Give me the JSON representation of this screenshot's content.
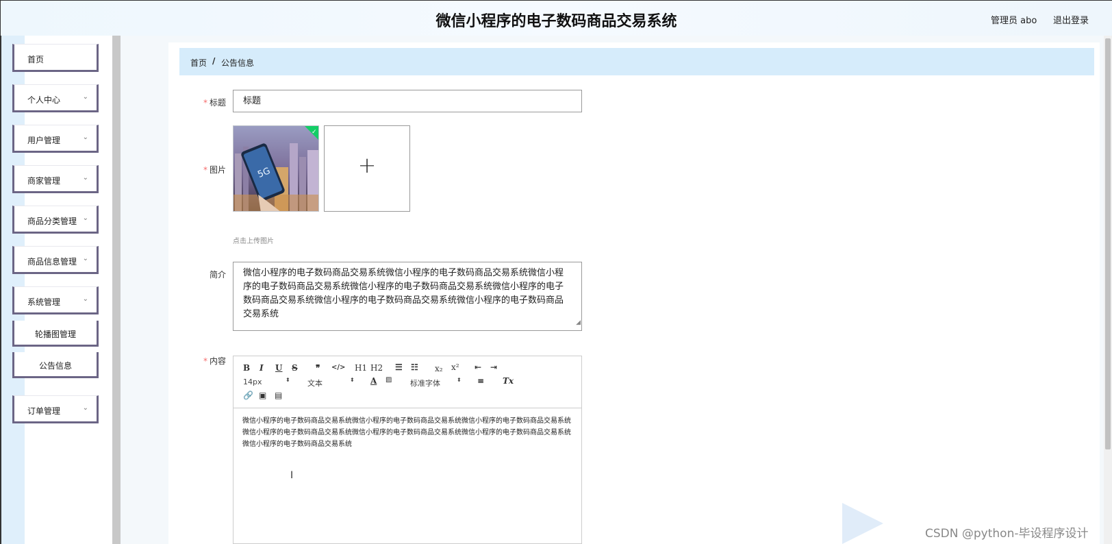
{
  "header": {
    "title": "微信小程序的电子数码商品交易系统",
    "admin_label": "管理员 abo",
    "logout_label": "退出登录"
  },
  "sidebar": {
    "items": [
      {
        "label": "首页"
      },
      {
        "label": "个人中心"
      },
      {
        "label": "用户管理"
      },
      {
        "label": "商家管理"
      },
      {
        "label": "商品分类管理"
      },
      {
        "label": "商品信息管理"
      },
      {
        "label": "系统管理"
      },
      {
        "label": "轮播图管理"
      },
      {
        "label": "公告信息"
      },
      {
        "label": "订单管理"
      }
    ]
  },
  "breadcrumb": {
    "home": "首页",
    "separator": "/",
    "current": "公告信息"
  },
  "form": {
    "title_label": "标题",
    "title_value": "标题",
    "image_label": "图片",
    "upload_tip": "点击上传图片",
    "summary_label": "简介",
    "summary_value": "微信小程序的电子数码商品交易系统微信小程序的电子数码商品交易系统微信小程序的电子数码商品交易系统微信小程序的电子数码商品交易系统微信小程序的电子数码商品交易系统微信小程序的电子数码商品交易系统微信小程序的电子数码商品交易系统",
    "content_label": "内容",
    "content_value": "微信小程序的电子数码商品交易系统微信小程序的电子数码商品交易系统微信小程序的电子数码商品交易系统微信小程序的电子数码商品交易系统微信小程序的电子数码商品交易系统微信小程序的电子数码商品交易系统微信小程序的电子数码商品交易系统",
    "thumb_badge_text": "5G"
  },
  "editor": {
    "font_size": "14px",
    "text_type": "文本",
    "font_family": "标准字体",
    "buttons": {
      "bold": "B",
      "italic": "I",
      "underline": "U",
      "strike": "S",
      "quote": "❞",
      "code": "</>",
      "h1": "H1",
      "h2": "H2",
      "sub": "x₂",
      "sup": "x²",
      "clear": "Tx"
    }
  },
  "watermark": "CSDN @python-毕设程序设计",
  "colors": {
    "sidebar_border": "#6b6585",
    "breadcrumb_bg": "#d6ecfb",
    "required": "#f56c6c"
  }
}
